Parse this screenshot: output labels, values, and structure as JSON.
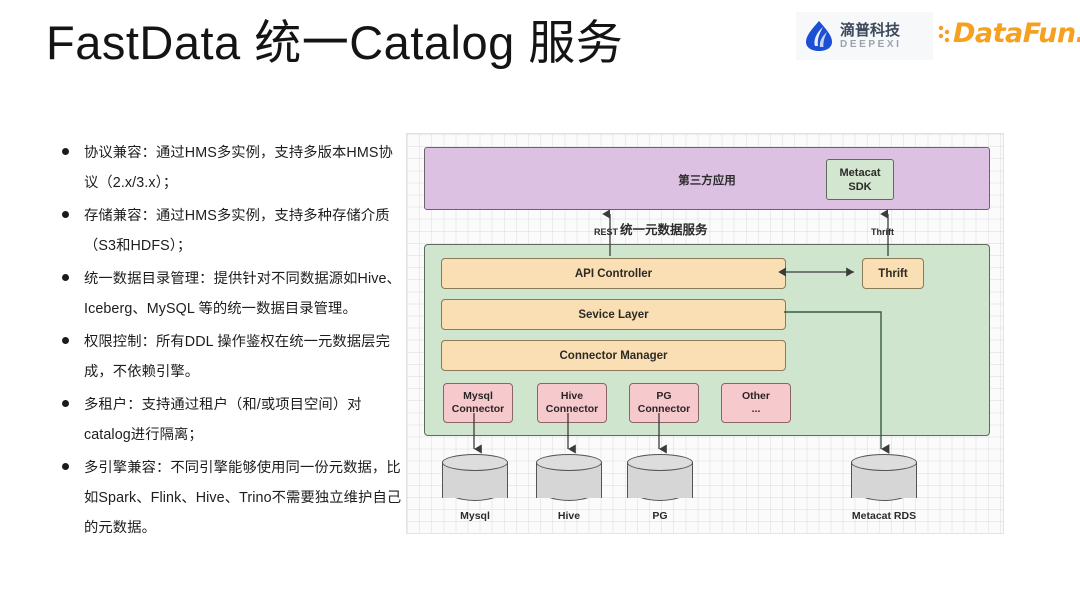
{
  "slide": {
    "title": "FastData 统一Catalog 服务"
  },
  "logos": {
    "deepexi": {
      "icon": "water-drop-logo",
      "cn": "滴普科技",
      "en": "DEEPEXI"
    },
    "datafun": {
      "icon": "datafun-dots-logo",
      "text": "DataFun."
    }
  },
  "bullets": [
    {
      "text": "协议兼容：通过HMS多实例，支持多版本HMS协议（2.x/3.x）；"
    },
    {
      "text": "存储兼容：通过HMS多实例，支持多种存储介质（S3和HDFS）；"
    },
    {
      "text": "统一数据目录管理：提供针对不同数据源如Hive、Iceberg、MySQL 等的统一数据目录管理。"
    },
    {
      "text": "权限控制：所有DDL 操作鉴权在统一元数据层完成，不依赖引擎。"
    },
    {
      "text": "多租户：支持通过租户（和/或项目空间）对catalog进行隔离；"
    },
    {
      "text": "多引擎兼容：不同引擎能够使用同一份元数据，比如Spark、Flink、Hive、Trino不需要独立维护自己的元数据。"
    }
  ],
  "diagram": {
    "app_layer": {
      "label": "第三方应用",
      "sdk_label": "Metacat\nSDK",
      "sdk_line1": "Metacat",
      "sdk_line2": "SDK",
      "color": "#ddc1e3"
    },
    "service_title": "统一元数据服务",
    "arrows": {
      "rest": "REST",
      "thrift": "Thrift"
    },
    "service_layer": {
      "color": "#cfe5cd",
      "bars": [
        {
          "label": "API Controller"
        },
        {
          "label": "Sevice Layer"
        },
        {
          "label": "Connector Manager"
        }
      ],
      "thrift_box": "Thrift",
      "connectors": [
        {
          "line1": "Mysql",
          "line2": "Connector"
        },
        {
          "line1": "Hive",
          "line2": "Connector"
        },
        {
          "line1": "PG",
          "line2": "Connector"
        },
        {
          "line1": "Other",
          "line2": "..."
        }
      ],
      "connector_color": "#f6c9cd",
      "bar_color": "#fadfb4"
    },
    "datastores": [
      {
        "label": "Mysql"
      },
      {
        "label": "Hive"
      },
      {
        "label": "PG"
      },
      {
        "label": "Metacat RDS"
      }
    ]
  }
}
